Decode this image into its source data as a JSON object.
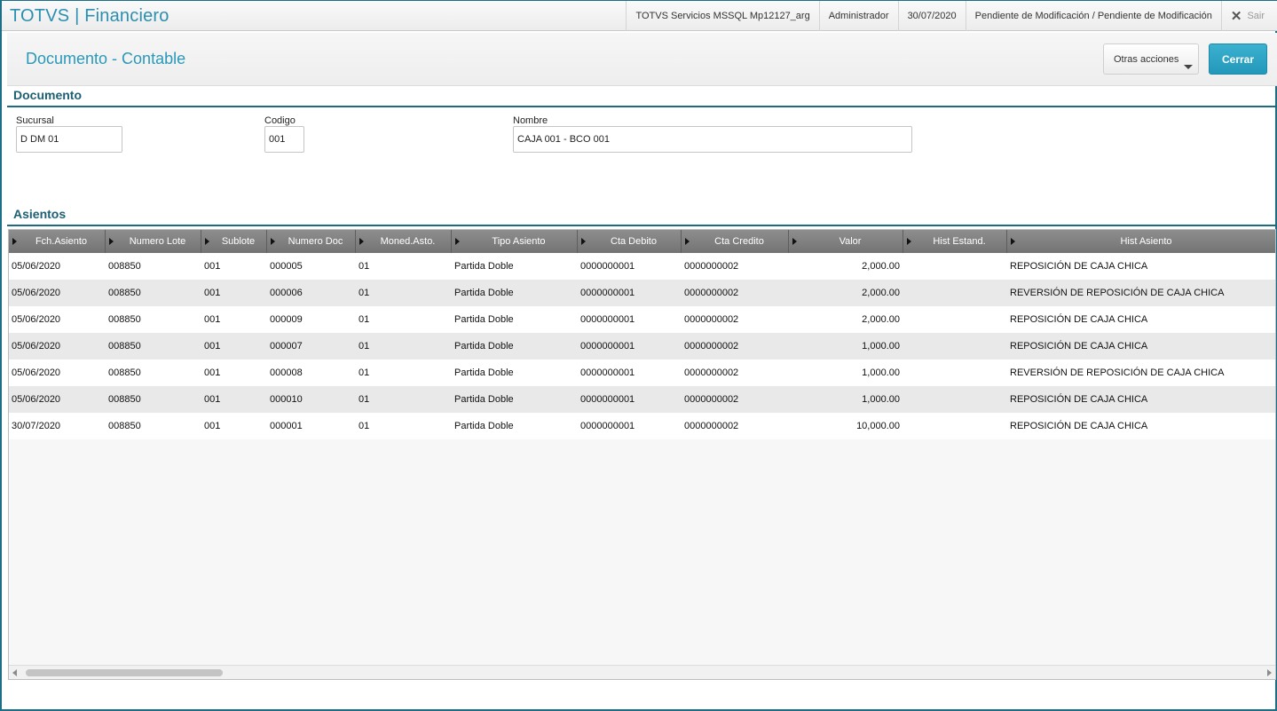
{
  "app": {
    "brand": "TOTVS | Financiero",
    "environment": "TOTVS Servicios MSSQL Mp12127_arg",
    "user": "Administrador",
    "date": "30/07/2020",
    "status": "Pendiente de Modificación / Pendiente de Modificación",
    "exit_label": "Sair"
  },
  "header": {
    "title": "Documento - Contable",
    "more_actions_label": "Otras acciones",
    "close_label": "Cerrar"
  },
  "documento": {
    "section_title": "Documento",
    "sucursal_label": "Sucursal",
    "sucursal_value": "D DM 01",
    "codigo_label": "Codigo",
    "codigo_value": "001",
    "nombre_label": "Nombre",
    "nombre_value": "CAJA 001 - BCO 001"
  },
  "asientos": {
    "section_title": "Asientos",
    "columns": [
      "Fch.Asiento",
      "Numero Lote",
      "Sublote",
      "Numero Doc",
      "Moned.Asto.",
      "Tipo Asiento",
      "Cta Debito",
      "Cta Credito",
      "Valor",
      "Hist Estand.",
      "Hist Asiento"
    ],
    "rows": [
      [
        "05/06/2020",
        "008850",
        "001",
        "000005",
        "01",
        "Partida Doble",
        "0000000001",
        "0000000002",
        "2,000.00",
        "",
        "REPOSICIÓN DE CAJA CHICA"
      ],
      [
        "05/06/2020",
        "008850",
        "001",
        "000006",
        "01",
        "Partida Doble",
        "0000000001",
        "0000000002",
        "2,000.00",
        "",
        "REVERSIÓN DE REPOSICIÓN DE CAJA CHICA"
      ],
      [
        "05/06/2020",
        "008850",
        "001",
        "000009",
        "01",
        "Partida Doble",
        "0000000001",
        "0000000002",
        "2,000.00",
        "",
        "REPOSICIÓN DE CAJA CHICA"
      ],
      [
        "05/06/2020",
        "008850",
        "001",
        "000007",
        "01",
        "Partida Doble",
        "0000000001",
        "0000000002",
        "1,000.00",
        "",
        "REPOSICIÓN DE CAJA CHICA"
      ],
      [
        "05/06/2020",
        "008850",
        "001",
        "000008",
        "01",
        "Partida Doble",
        "0000000001",
        "0000000002",
        "1,000.00",
        "",
        "REVERSIÓN DE REPOSICIÓN DE CAJA CHICA"
      ],
      [
        "05/06/2020",
        "008850",
        "001",
        "000010",
        "01",
        "Partida Doble",
        "0000000001",
        "0000000002",
        "1,000.00",
        "",
        "REPOSICIÓN DE CAJA CHICA"
      ],
      [
        "30/07/2020",
        "008850",
        "001",
        "000001",
        "01",
        "Partida Doble",
        "0000000001",
        "0000000002",
        "10,000.00",
        "",
        "REPOSICIÓN DE CAJA CHICA"
      ]
    ]
  }
}
